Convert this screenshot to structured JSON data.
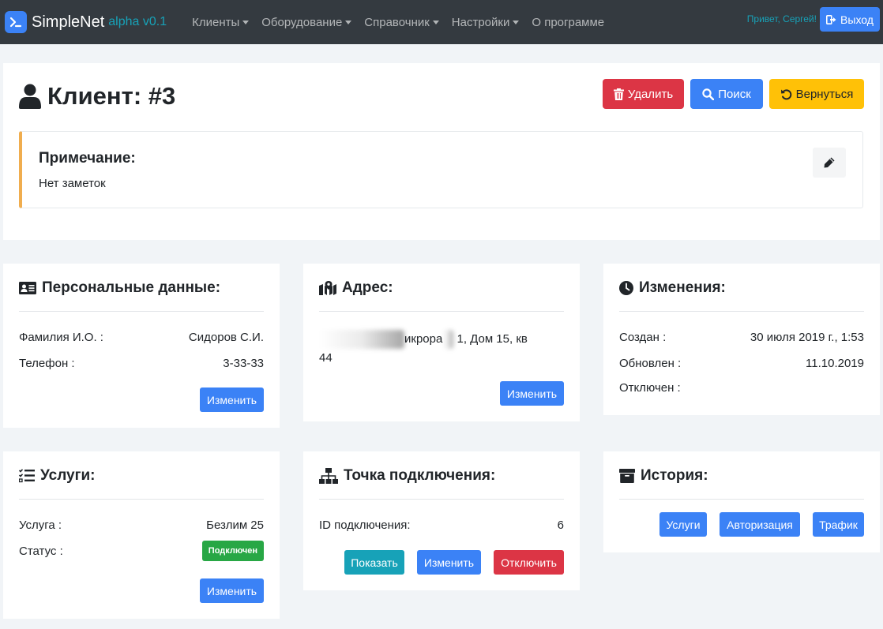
{
  "navbar": {
    "brand_name": "SimpleNet",
    "brand_version": "alpha v0.1",
    "menu": [
      "Клиенты",
      "Оборудование",
      "Справочник",
      "Настройки",
      "О программе"
    ],
    "greeting": "Привет, Сергей!",
    "logout_label": "Выход"
  },
  "client": {
    "title": "Клиент: #3",
    "delete_label": "Удалить",
    "search_label": "Поиск",
    "back_label": "Вернуться",
    "note_title": "Примечание:",
    "note_text": "Нет заметок"
  },
  "personal": {
    "title": "Персональные данные:",
    "rows": [
      {
        "label": "Фамилия И.О. :",
        "value": "Сидоров С.И."
      },
      {
        "label": "Телефон :",
        "value": "3-33-33"
      }
    ],
    "edit_label": "Изменить"
  },
  "address": {
    "title": "Адрес:",
    "text_visible_1": "икрора",
    "text_visible_2": "1, Дом 15, кв",
    "text_visible_3": "44",
    "edit_label": "Изменить"
  },
  "changes": {
    "title": "Изменения:",
    "rows": [
      {
        "label": "Создан :",
        "value": "30 июля 2019 г., 1:53"
      },
      {
        "label": "Обновлен :",
        "value": "11.10.2019"
      },
      {
        "label": "Отключен :",
        "value": ""
      }
    ]
  },
  "services": {
    "title": "Услуги:",
    "service_label": "Услуга :",
    "service_value": "Безлим 25",
    "status_label": "Статус :",
    "status_value": "Подключен",
    "edit_label": "Изменить"
  },
  "connection": {
    "title": "Точка подключения:",
    "id_label": "ID подключения:",
    "id_value": "6",
    "show_label": "Показать",
    "edit_label": "Изменить",
    "disconnect_label": "Отключить"
  },
  "history": {
    "title": "История:",
    "services_label": "Услуги",
    "auth_label": "Авторизация",
    "traffic_label": "Трафик"
  },
  "colors": {
    "navbar": "#343a40",
    "primary": "#3b82f6",
    "danger": "#dc3545",
    "warning": "#ffc107",
    "info": "#17a2b8",
    "success": "#28a745"
  },
  "icons": [
    "terminal-icon",
    "user-icon",
    "trash-icon",
    "search-icon",
    "undo-icon",
    "pencil-icon",
    "id-card-icon",
    "map-marked-icon",
    "clock-icon",
    "tasks-icon",
    "network-icon",
    "archive-icon",
    "sign-out-icon"
  ]
}
